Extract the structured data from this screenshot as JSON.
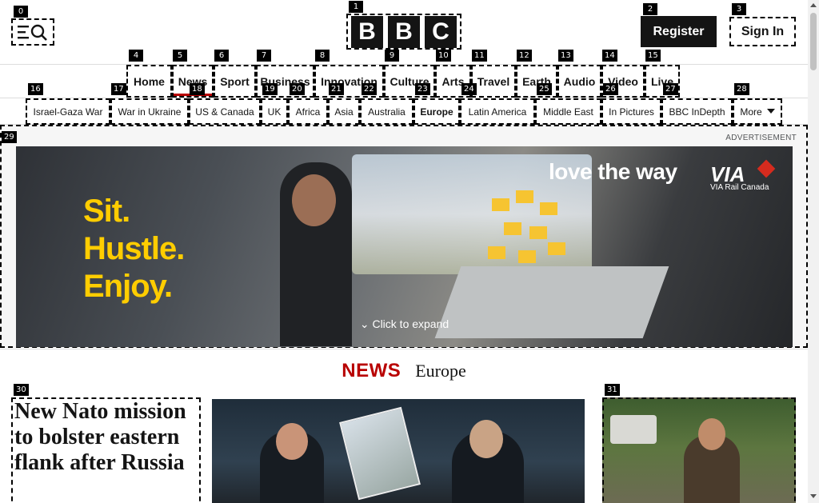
{
  "header": {
    "logo_letters": [
      "B",
      "B",
      "C"
    ],
    "register_label": "Register",
    "signin_label": "Sign In"
  },
  "primary_nav": [
    {
      "label": "Home"
    },
    {
      "label": "News",
      "active": true
    },
    {
      "label": "Sport"
    },
    {
      "label": "Business"
    },
    {
      "label": "Innovation"
    },
    {
      "label": "Culture"
    },
    {
      "label": "Arts"
    },
    {
      "label": "Travel"
    },
    {
      "label": "Earth"
    },
    {
      "label": "Audio"
    },
    {
      "label": "Video"
    },
    {
      "label": "Live"
    }
  ],
  "secondary_nav": [
    {
      "label": "Israel-Gaza War"
    },
    {
      "label": "War in Ukraine"
    },
    {
      "label": "US & Canada"
    },
    {
      "label": "UK"
    },
    {
      "label": "Africa"
    },
    {
      "label": "Asia"
    },
    {
      "label": "Australia"
    },
    {
      "label": "Europe",
      "current": true
    },
    {
      "label": "Latin America"
    },
    {
      "label": "Middle East"
    },
    {
      "label": "In Pictures"
    },
    {
      "label": "BBC InDepth"
    },
    {
      "label": "More"
    }
  ],
  "ad": {
    "label": "ADVERTISEMENT",
    "slogan_lines": [
      "Sit.",
      "Hustle.",
      "Enjoy."
    ],
    "tagline": "love the way",
    "brand": "VIA",
    "brand_sub": "VIA Rail Canada",
    "expand_label": "Click to expand"
  },
  "section": {
    "news_word": "NEWS",
    "section_name": "Europe"
  },
  "lead_story": {
    "headline": "New Nato mission to bolster eastern flank after Russia"
  },
  "badges": [
    "0",
    "1",
    "2",
    "3",
    "4",
    "5",
    "6",
    "7",
    "8",
    "9",
    "10",
    "11",
    "12",
    "13",
    "14",
    "15",
    "16",
    "17",
    "18",
    "19",
    "20",
    "21",
    "22",
    "23",
    "24",
    "25",
    "26",
    "27",
    "28",
    "29",
    "30",
    "31"
  ],
  "colors": {
    "bbc_red": "#b80000",
    "ad_yellow": "#ffcd00",
    "ink": "#141414"
  }
}
